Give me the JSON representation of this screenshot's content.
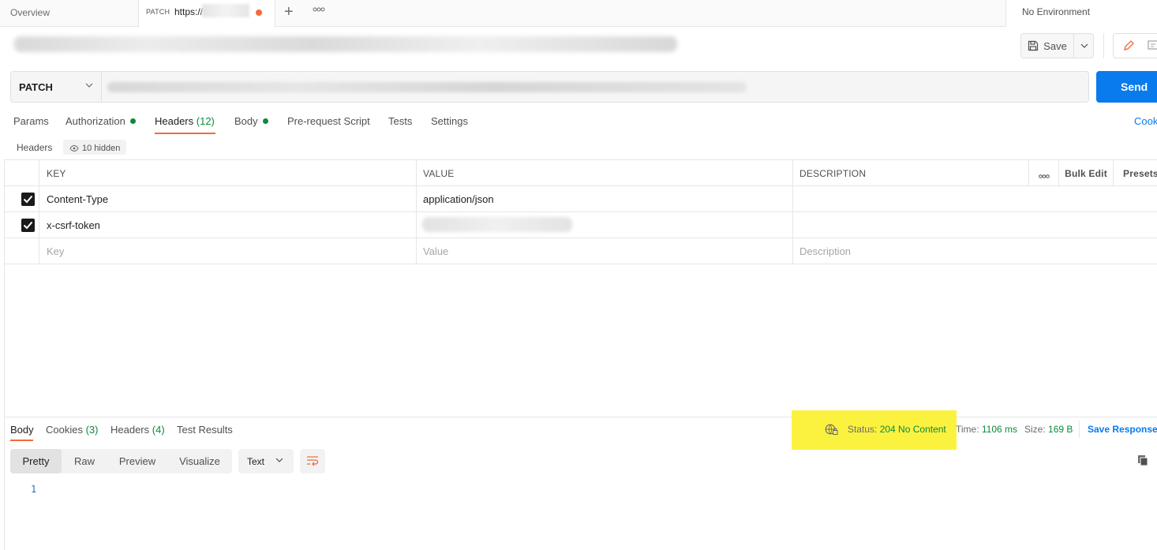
{
  "tabs": {
    "overview": "Overview",
    "active_method": "PATCH",
    "active_url": "https://",
    "add": "+",
    "more": "ooo",
    "environment": "No Environment"
  },
  "toolbar": {
    "save_label": "Save"
  },
  "request": {
    "method": "PATCH",
    "send_label": "Send"
  },
  "request_tabs": {
    "params": "Params",
    "authorization": "Authorization",
    "headers": "Headers",
    "headers_count": "(12)",
    "body": "Body",
    "prerequest": "Pre-request Script",
    "tests": "Tests",
    "settings": "Settings",
    "cookies": "Cook"
  },
  "headers_section": {
    "label": "Headers",
    "hidden": "10 hidden"
  },
  "headers_table": {
    "columns": {
      "key": "KEY",
      "value": "VALUE",
      "description": "DESCRIPTION",
      "more": "ooo",
      "bulk_edit": "Bulk Edit",
      "presets": "Presets"
    },
    "rows": [
      {
        "checked": true,
        "key": "Content-Type",
        "value": "application/json",
        "description": ""
      },
      {
        "checked": true,
        "key": "x-csrf-token",
        "value": "",
        "description": ""
      }
    ],
    "placeholders": {
      "key": "Key",
      "value": "Value",
      "description": "Description"
    }
  },
  "response": {
    "tabs": {
      "body": "Body",
      "cookies": "Cookies",
      "cookies_count": "(3)",
      "headers": "Headers",
      "headers_count": "(4)",
      "test_results": "Test Results"
    },
    "status_label": "Status:",
    "status_value": "204 No Content",
    "time_label": "Time:",
    "time_value": "1106 ms",
    "size_label": "Size:",
    "size_value": "169 B",
    "save_response": "Save Response",
    "view_modes": [
      "Pretty",
      "Raw",
      "Preview",
      "Visualize"
    ],
    "format": "Text",
    "line_number": "1"
  },
  "colors": {
    "accent": "#f26b3a",
    "send": "#097bed",
    "success": "#0b8a3a",
    "highlight": "#fbf240"
  }
}
